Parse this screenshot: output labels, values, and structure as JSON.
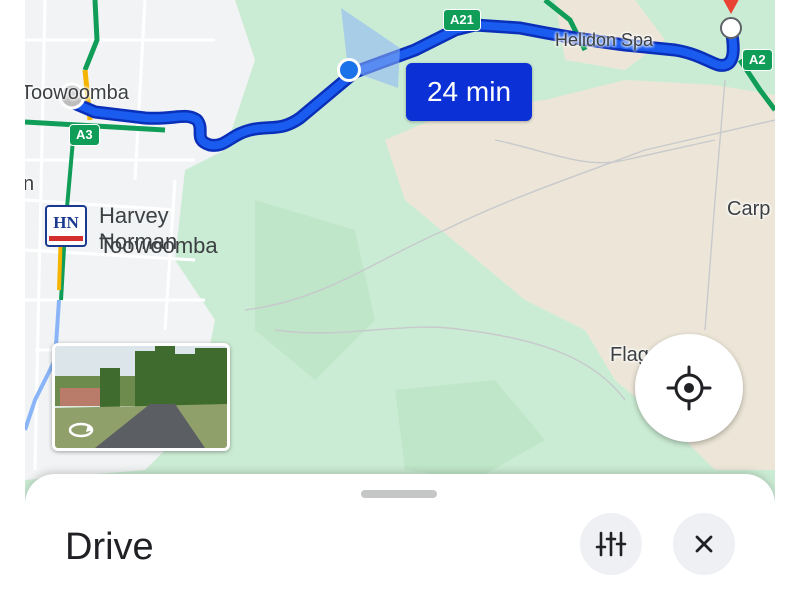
{
  "map": {
    "town_labels": [
      "Toowoomba",
      "Helidon Spa",
      "Carp",
      "Flag",
      "n"
    ],
    "road_shields": [
      "A21",
      "A2",
      "A3"
    ],
    "eta": "24 min",
    "poi": {
      "name_line1": "Harvey Norman",
      "name_line2": "Toowoomba",
      "logo_text": "HN"
    },
    "route_color": "#0b31d6",
    "map_colors": {
      "urban": "#f1f3f4",
      "green": "#c8ebd1",
      "terrain": "#ede6d8"
    }
  },
  "controls": {
    "my_location_icon": "crosshair-icon",
    "street_view_icon": "street-view-thumbnail"
  },
  "bottom_sheet": {
    "title": "Drive",
    "options_icon": "tune-icon",
    "close_icon": "close-icon"
  }
}
